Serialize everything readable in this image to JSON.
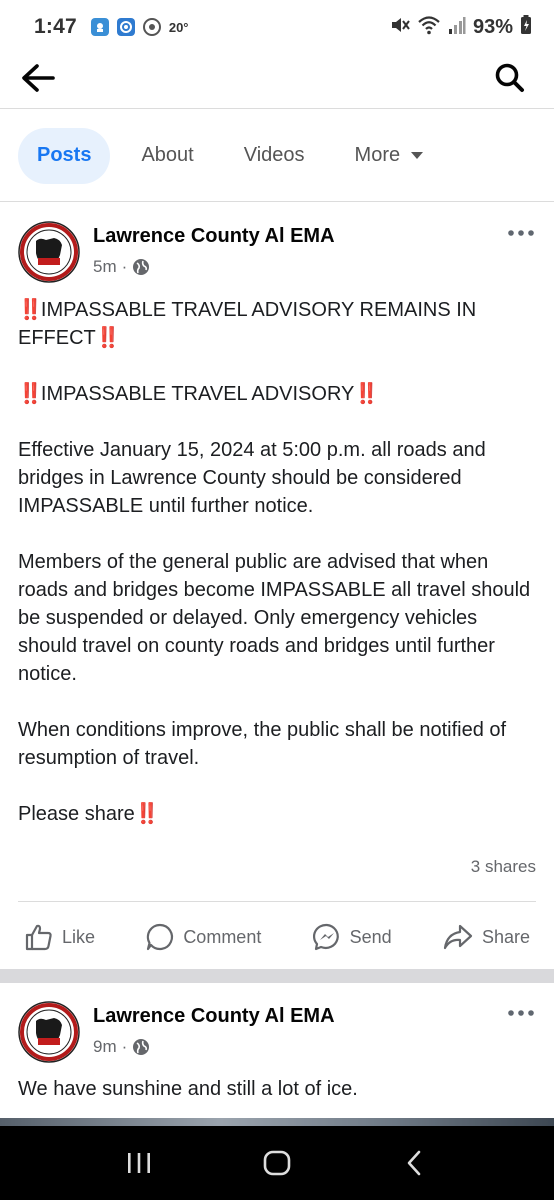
{
  "status_bar": {
    "time": "1:47",
    "temperature": "20°",
    "battery": "93%"
  },
  "top_nav": {
    "back_icon": "arrow-left-icon",
    "search_icon": "search-icon"
  },
  "tabs": [
    {
      "label": "Posts",
      "active": true
    },
    {
      "label": "About",
      "active": false
    },
    {
      "label": "Videos",
      "active": false
    },
    {
      "label": "More",
      "active": false
    }
  ],
  "posts": [
    {
      "page_name": "Lawrence County Al EMA",
      "time": "5m",
      "audience_icon": "globe-icon",
      "lines": {
        "l1": "IMPASSABLE TRAVEL ADVISORY REMAINS IN EFFECT",
        "l2": "IMPASSABLE TRAVEL ADVISORY",
        "l3": "Effective January 15, 2024 at 5:00 p.m. all roads and bridges in Lawrence County should be considered IMPASSABLE until further notice.",
        "l4": "Members of the general public are advised that when roads and bridges become IMPASSABLE all travel should be suspended or delayed. Only emergency vehicles should travel on county roads and bridges until further notice.",
        "l5": "When conditions improve, the public shall be notified of resumption of travel.",
        "l6": "Please share"
      },
      "emoji": "‼️",
      "shares": "3 shares",
      "actions": {
        "like": "Like",
        "comment": "Comment",
        "send": "Send",
        "share": "Share"
      }
    },
    {
      "page_name": "Lawrence County Al EMA",
      "time": "9m",
      "audience_icon": "globe-icon",
      "text": "We have sunshine and still a lot of ice."
    }
  ],
  "avatar_logo": {
    "ring_text": "LAWRENCE COUNTY",
    "center_text": "EMA",
    "script_text": "Lawrence County"
  },
  "colors": {
    "accent": "#1877f2",
    "active_tab_bg": "#e7f1fd",
    "alert_red": "#e0241b",
    "secondary_text": "#65676b"
  }
}
